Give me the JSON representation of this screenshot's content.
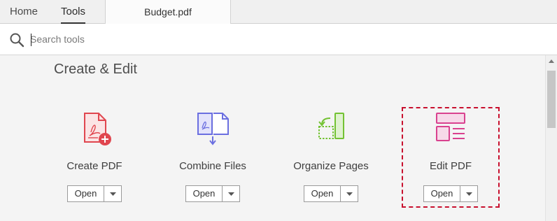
{
  "tabs": {
    "home": "Home",
    "tools": "Tools",
    "document": "Budget.pdf"
  },
  "search": {
    "placeholder": "Search tools",
    "value": ""
  },
  "section": {
    "title": "Create & Edit"
  },
  "tools": [
    {
      "label": "Create PDF",
      "button": "Open",
      "icon": "create-pdf-icon",
      "color": "#e0464f"
    },
    {
      "label": "Combine Files",
      "button": "Open",
      "icon": "combine-files-icon",
      "color": "#6b6fe0"
    },
    {
      "label": "Organize Pages",
      "button": "Open",
      "icon": "organize-pages-icon",
      "color": "#73c233"
    },
    {
      "label": "Edit PDF",
      "button": "Open",
      "icon": "edit-pdf-icon",
      "color": "#d9428f"
    }
  ],
  "highlight_color": "#c8102e"
}
